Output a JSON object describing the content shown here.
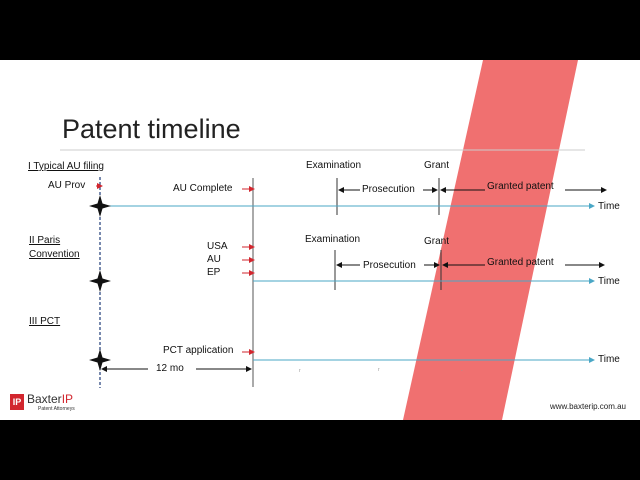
{
  "slide": {
    "title": "Patent timeline",
    "website": "www.baxterip.com.au"
  },
  "logo": {
    "mark": "IP",
    "name_part1": "Baxter",
    "name_part2": "IP",
    "tagline": "Patent Attorneys"
  },
  "sections": {
    "typical": {
      "heading": "I Typical AU filing",
      "au_prov": "AU Prov",
      "au_complete": "AU Complete",
      "examination": "Examination",
      "grant": "Grant",
      "prosecution": "Prosecution",
      "granted_patent": "Granted patent",
      "time": "Time"
    },
    "paris": {
      "heading_line1": "II Paris",
      "heading_line2": "Convention",
      "usa": "USA",
      "au": "AU",
      "ep": "EP",
      "examination": "Examination",
      "grant": "Grant",
      "prosecution": "Prosecution",
      "granted_patent": "Granted patent",
      "time": "Time"
    },
    "pct": {
      "heading": "III PCT",
      "pct_application": "PCT application",
      "twelve_mo": "12 mo",
      "time": "Time"
    }
  },
  "colors": {
    "timeline": "#4aa7c6",
    "arrow_red": "#d2262e",
    "band": "#f07070",
    "star": "#111111",
    "dashed": "#1f3b77"
  }
}
